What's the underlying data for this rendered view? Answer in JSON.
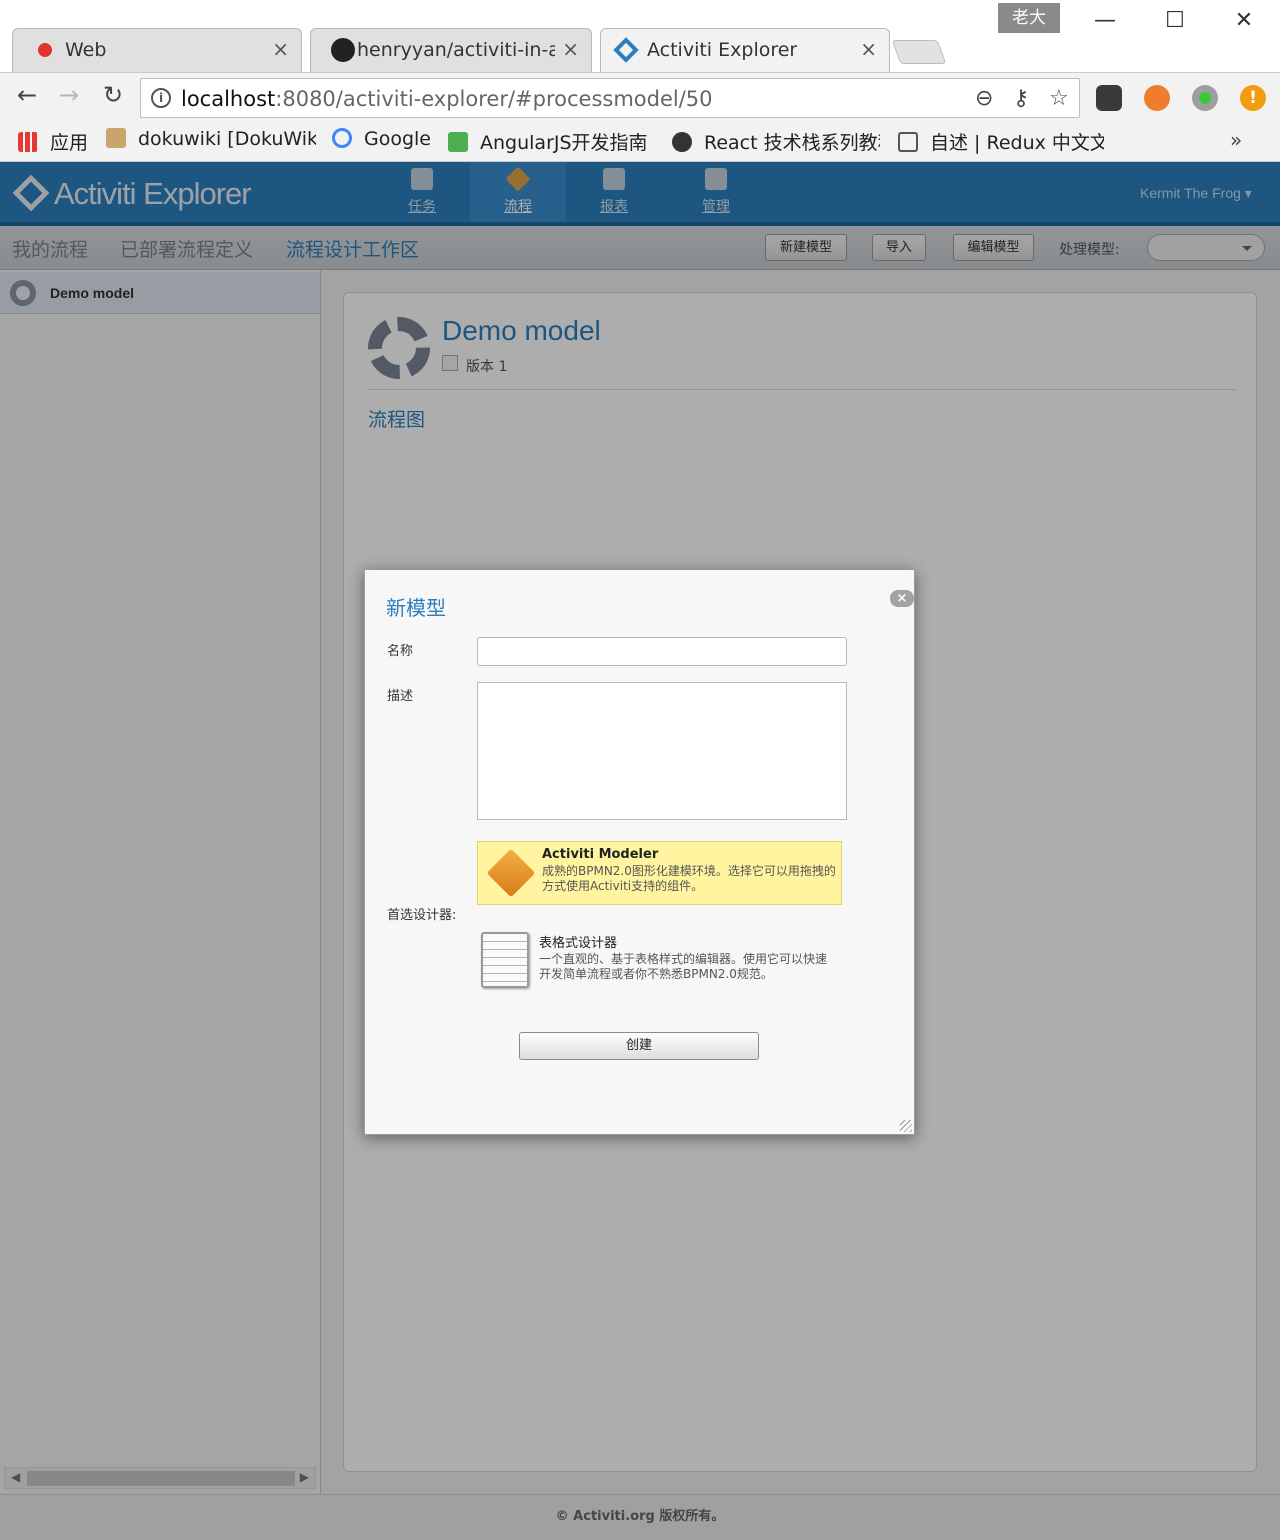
{
  "browser": {
    "profile": "老大",
    "tabs": [
      {
        "title": "Web",
        "close": "×"
      },
      {
        "title": "henryyan/activiti-in-act",
        "close": "×"
      },
      {
        "title": "Activiti Explorer",
        "close": "×"
      }
    ],
    "url_host": "localhost",
    "url_rest": ":8080/activiti-explorer/#processmodel/50",
    "bookmarks": [
      {
        "label": "应用"
      },
      {
        "label": "dokuwiki [DokuWik"
      },
      {
        "label": "Google"
      },
      {
        "label": "AngularJS开发指南 ᴾ"
      },
      {
        "label": "React 技术栈系列教程"
      },
      {
        "label": "自述 | Redux 中文文"
      }
    ],
    "more": "»"
  },
  "app": {
    "logo": "Activiti Explorer",
    "nav": [
      {
        "label": "任务"
      },
      {
        "label": "流程"
      },
      {
        "label": "报表"
      },
      {
        "label": "管理"
      }
    ],
    "user": "Kermit The Frog ▾",
    "subnav": {
      "my_process": "我的流程",
      "deployed": "已部署流程定义",
      "workspace": "流程设计工作区"
    },
    "actions": {
      "new_model": "新建模型",
      "import": "导入",
      "edit_model": "编辑模型",
      "process_model_label": "处理模型:"
    },
    "sidebar": {
      "items": [
        {
          "label": "Demo model"
        }
      ]
    },
    "model": {
      "title": "Demo model",
      "version": "版本 1",
      "diagram_label": "流程图"
    },
    "footer": "© Activiti.org 版权所有。"
  },
  "dialog": {
    "title": "新模型",
    "close": "×",
    "name_label": "名称",
    "name_value": "",
    "desc_label": "描述",
    "desc_value": "",
    "designer_label": "首选设计器:",
    "options": [
      {
        "title": "Activiti Modeler",
        "desc": "成熟的BPMN2.0图形化建模环境。选择它可以用拖拽的方式使用Activiti支持的组件。"
      },
      {
        "title": "表格式设计器",
        "desc": "一个直观的、基于表格样式的编辑器。使用它可以快速开发简单流程或者你不熟悉BPMN2.0规范。"
      }
    ],
    "create": "创建"
  },
  "colors": {
    "accent": "#2b7fbf",
    "modeler_highlight": "#fff5a0"
  }
}
